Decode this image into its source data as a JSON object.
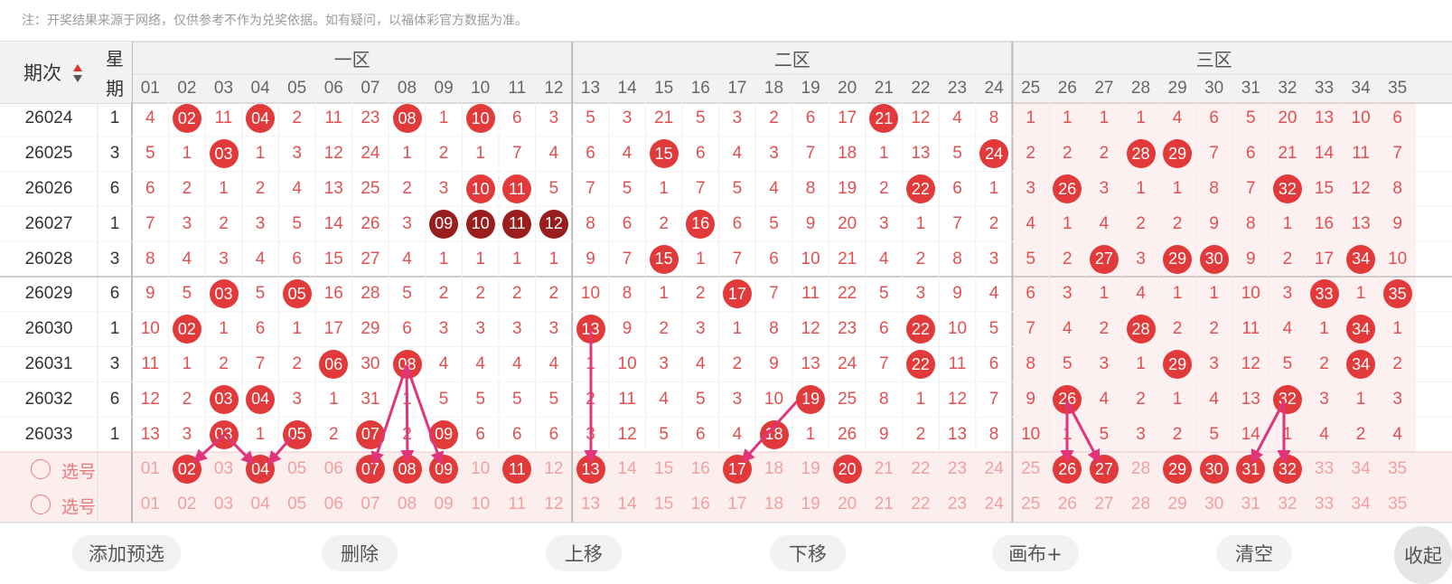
{
  "note": "注：开奖结果来源于网络，仅供参考不作为兑奖依据。如有疑问，以福体彩官方数据为准。",
  "header": {
    "issue_label": "期次",
    "week_label_1": "星",
    "week_label_2": "期",
    "zones": [
      "一区",
      "二区",
      "三区"
    ],
    "columns": [
      "01",
      "02",
      "03",
      "04",
      "05",
      "06",
      "07",
      "08",
      "09",
      "10",
      "11",
      "12",
      "13",
      "14",
      "15",
      "16",
      "17",
      "18",
      "19",
      "20",
      "21",
      "22",
      "23",
      "24",
      "25",
      "26",
      "27",
      "28",
      "29",
      "30",
      "31",
      "32",
      "33",
      "34",
      "35"
    ]
  },
  "rows": [
    {
      "issue": "26024",
      "week": "1",
      "cells": [
        "4",
        "02",
        "11",
        "04",
        "2",
        "11",
        "23",
        "08",
        "1",
        "10",
        "6",
        "3",
        "5",
        "3",
        "21",
        "5",
        "3",
        "2",
        "6",
        "17",
        "21",
        "12",
        "4",
        "8",
        "1",
        "1",
        "1",
        "1",
        "4",
        "6",
        "5",
        "20",
        "13",
        "10",
        "6"
      ],
      "balls": [
        2,
        4,
        8,
        10,
        21
      ]
    },
    {
      "issue": "26025",
      "week": "3",
      "cells": [
        "5",
        "1",
        "03",
        "1",
        "3",
        "12",
        "24",
        "1",
        "2",
        "1",
        "7",
        "4",
        "6",
        "4",
        "15",
        "6",
        "4",
        "3",
        "7",
        "18",
        "1",
        "13",
        "5",
        "24",
        "2",
        "2",
        "2",
        "28",
        "29",
        "7",
        "6",
        "21",
        "14",
        "11",
        "7"
      ],
      "balls": [
        3,
        15,
        24,
        28,
        29
      ]
    },
    {
      "issue": "26026",
      "week": "6",
      "cells": [
        "6",
        "2",
        "1",
        "2",
        "4",
        "13",
        "25",
        "2",
        "3",
        "10",
        "11",
        "5",
        "7",
        "5",
        "1",
        "7",
        "5",
        "4",
        "8",
        "19",
        "2",
        "22",
        "6",
        "1",
        "3",
        "26",
        "3",
        "1",
        "1",
        "8",
        "7",
        "32",
        "15",
        "12",
        "8"
      ],
      "balls": [
        10,
        11,
        22,
        26,
        32
      ]
    },
    {
      "issue": "26027",
      "week": "1",
      "cells": [
        "7",
        "3",
        "2",
        "3",
        "5",
        "14",
        "26",
        "3",
        "09",
        "10",
        "11",
        "12",
        "8",
        "6",
        "2",
        "16",
        "6",
        "5",
        "9",
        "20",
        "3",
        "1",
        "7",
        "2",
        "4",
        "1",
        "4",
        "2",
        "2",
        "9",
        "8",
        "1",
        "16",
        "13",
        "9"
      ],
      "balls": [
        9,
        10,
        11,
        12,
        16
      ],
      "dark": [
        9,
        10,
        11,
        12
      ]
    },
    {
      "issue": "26028",
      "week": "3",
      "cells": [
        "8",
        "4",
        "3",
        "4",
        "6",
        "15",
        "27",
        "4",
        "1",
        "1",
        "1",
        "1",
        "9",
        "7",
        "15",
        "1",
        "7",
        "6",
        "10",
        "21",
        "4",
        "2",
        "8",
        "3",
        "5",
        "2",
        "27",
        "3",
        "29",
        "30",
        "9",
        "2",
        "17",
        "34",
        "10"
      ],
      "balls": [
        15,
        27,
        29,
        30,
        34
      ]
    },
    {
      "issue": "26029",
      "week": "6",
      "cells": [
        "9",
        "5",
        "03",
        "5",
        "05",
        "16",
        "28",
        "5",
        "2",
        "2",
        "2",
        "2",
        "10",
        "8",
        "1",
        "2",
        "17",
        "7",
        "11",
        "22",
        "5",
        "3",
        "9",
        "4",
        "6",
        "3",
        "1",
        "4",
        "1",
        "1",
        "10",
        "3",
        "33",
        "1",
        "35"
      ],
      "balls": [
        3,
        5,
        17,
        33,
        35
      ]
    },
    {
      "issue": "26030",
      "week": "1",
      "cells": [
        "10",
        "02",
        "1",
        "6",
        "1",
        "17",
        "29",
        "6",
        "3",
        "3",
        "3",
        "3",
        "13",
        "9",
        "2",
        "3",
        "1",
        "8",
        "12",
        "23",
        "6",
        "22",
        "10",
        "5",
        "7",
        "4",
        "2",
        "28",
        "2",
        "2",
        "11",
        "4",
        "1",
        "34",
        "1"
      ],
      "balls": [
        2,
        13,
        22,
        28,
        34
      ]
    },
    {
      "issue": "26031",
      "week": "3",
      "cells": [
        "11",
        "1",
        "2",
        "7",
        "2",
        "06",
        "30",
        "08",
        "4",
        "4",
        "4",
        "4",
        "1",
        "10",
        "3",
        "4",
        "2",
        "9",
        "13",
        "24",
        "7",
        "22",
        "11",
        "6",
        "8",
        "5",
        "3",
        "1",
        "29",
        "3",
        "12",
        "5",
        "2",
        "34",
        "2"
      ],
      "balls": [
        6,
        8,
        22,
        29,
        34
      ]
    },
    {
      "issue": "26032",
      "week": "6",
      "cells": [
        "12",
        "2",
        "03",
        "04",
        "3",
        "1",
        "31",
        "1",
        "5",
        "5",
        "5",
        "5",
        "2",
        "11",
        "4",
        "5",
        "3",
        "10",
        "19",
        "25",
        "8",
        "1",
        "12",
        "7",
        "9",
        "26",
        "4",
        "2",
        "1",
        "4",
        "13",
        "32",
        "3",
        "1",
        "3"
      ],
      "balls": [
        3,
        4,
        19,
        26,
        32
      ]
    },
    {
      "issue": "26033",
      "week": "1",
      "cells": [
        "13",
        "3",
        "03",
        "1",
        "05",
        "2",
        "07",
        "2",
        "09",
        "6",
        "6",
        "6",
        "3",
        "12",
        "5",
        "6",
        "4",
        "18",
        "1",
        "26",
        "9",
        "2",
        "13",
        "8",
        "10",
        "1",
        "5",
        "3",
        "2",
        "5",
        "14",
        "1",
        "4",
        "2",
        "4"
      ],
      "balls": [
        3,
        5,
        7,
        9,
        18
      ]
    }
  ],
  "select_rows": [
    {
      "label": "选号",
      "balls": [
        2,
        4,
        7,
        8,
        9,
        11,
        13,
        17,
        20,
        26,
        27,
        29,
        30,
        31,
        32
      ]
    },
    {
      "label": "选号",
      "balls": []
    }
  ],
  "buttons": {
    "add": "添加预选",
    "delete": "删除",
    "up": "上移",
    "down": "下移",
    "canvas": "画布+",
    "clear": "清空",
    "collapse": "收起"
  }
}
